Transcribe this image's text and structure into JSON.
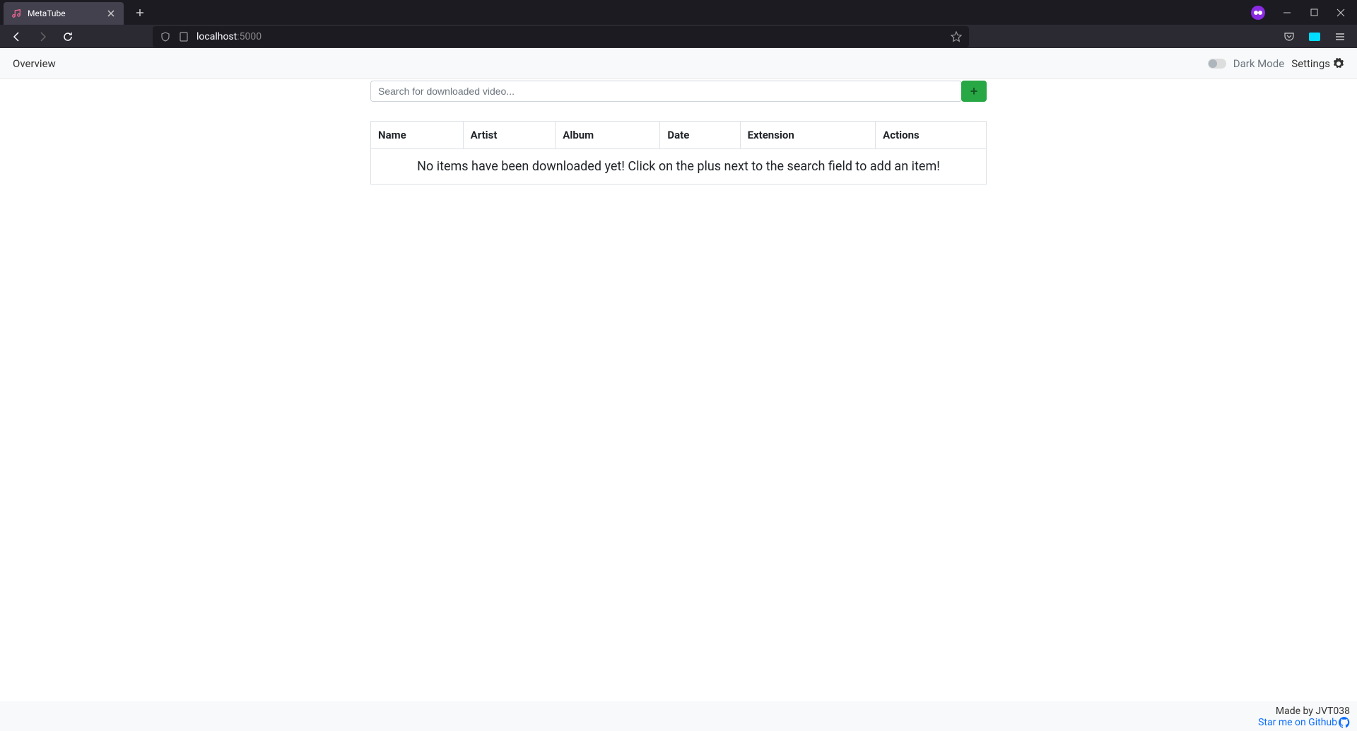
{
  "browser": {
    "tab_title": "MetaTube",
    "url_host": "localhost",
    "url_port": ":5000"
  },
  "header": {
    "overview_label": "Overview",
    "dark_mode_label": "Dark Mode",
    "settings_label": "Settings"
  },
  "search": {
    "placeholder": "Search for downloaded video...",
    "add_button_label": "+"
  },
  "table": {
    "columns": [
      "Name",
      "Artist",
      "Album",
      "Date",
      "Extension",
      "Actions"
    ],
    "empty_message": "No items have been downloaded yet! Click on the plus next to the search field to add an item!"
  },
  "footer": {
    "made_by": "Made by JVT038",
    "github_link": "Star me on Github"
  }
}
